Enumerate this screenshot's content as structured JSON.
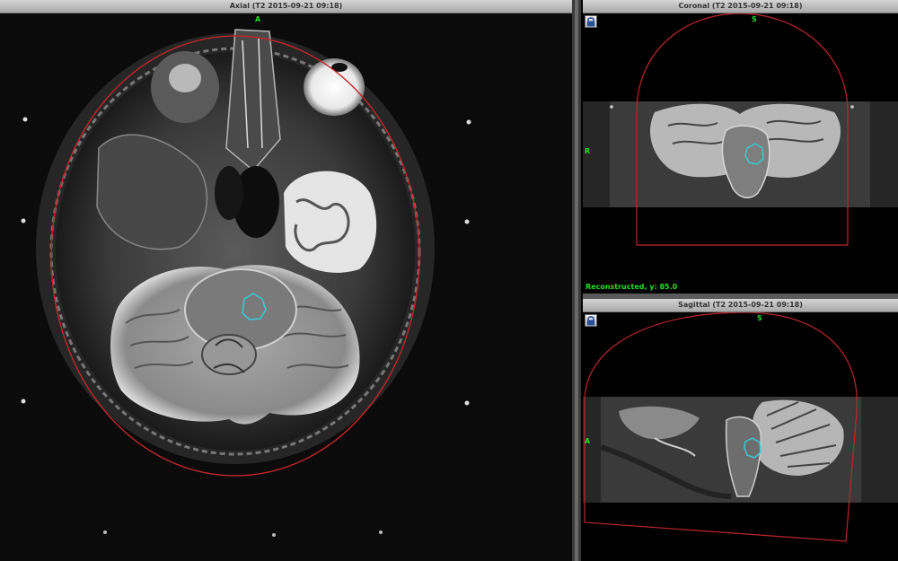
{
  "axial": {
    "title": "Axial (T2 2015-09-21 09:18)",
    "orient_top": "A"
  },
  "coronal": {
    "title": "Coronal (T2 2015-09-21 09:18)",
    "orient_top": "S",
    "orient_left": "R",
    "status": "Reconstructed, y: 85.0"
  },
  "sagittal": {
    "title": "Sagittal (T2 2015-09-21 09:18)",
    "orient_top": "S",
    "orient_left": "A"
  },
  "colors": {
    "contour": "#c0262b",
    "roi": "#3cc8d2",
    "orientation": "#22e022"
  },
  "icons": {
    "lock": "lock-icon"
  }
}
